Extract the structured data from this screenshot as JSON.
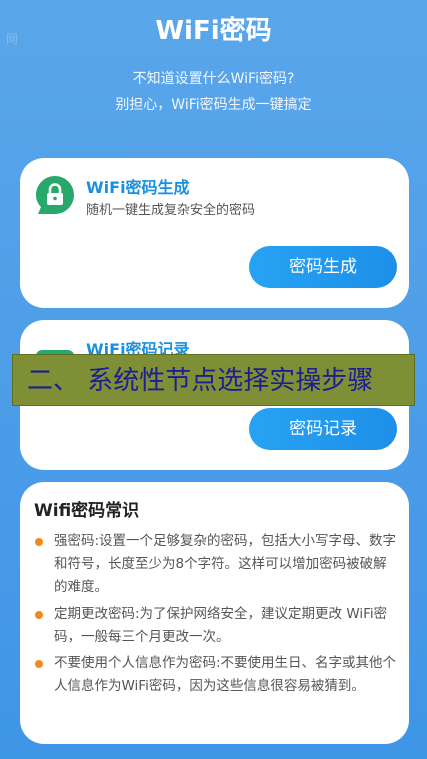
{
  "app": {
    "title": "WiFi密码",
    "watermark": "网",
    "subtitle_line1": "不知道设置什么WiFi密码?",
    "subtitle_line2": "别担心，WiFi密码生成一键搞定"
  },
  "generate_card": {
    "title": "WiFi密码生成",
    "description": "随机一键生成复杂安全的密码",
    "button_label": "密码生成",
    "icon": "lock-chat-icon"
  },
  "record_card": {
    "title": "WiFi密码记录",
    "button_label": "密码记录",
    "icon": "record-icon"
  },
  "overlay_banner": {
    "text": "二、 系统性节点选择实操步骤"
  },
  "knowledge_card": {
    "title": "Wifi密码常识",
    "tips": [
      "强密码:设置一个足够复杂的密码，包括大小写字母、数字和符号，长度至少为8个字符。这样可以增加密码被破解的难度。",
      "定期更改密码:为了保护网络安全，建议定期更改 WiFi密码，一般每三个月更改一次。",
      "不要使用个人信息作为密码:不要使用生日、名字或其他个人信息作为WiFi密码，因为这些信息很容易被猜到。"
    ]
  },
  "colors": {
    "background": "#4a9de8",
    "accent": "#1b8fe0",
    "icon_green": "#29a86c",
    "bullet_orange": "#f08a1b",
    "banner_olive": "#7f8f36",
    "banner_text": "#1d1e91"
  }
}
